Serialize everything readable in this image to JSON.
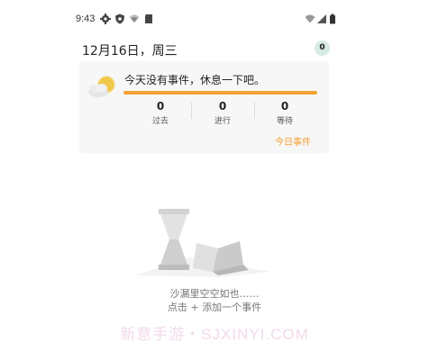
{
  "status_bar": {
    "time": "9:43",
    "left_icons": [
      "gear-icon",
      "shield-icon",
      "wifi-off-icon",
      "sd-card-icon"
    ],
    "right_icons": [
      "wifi-icon",
      "signal-icon",
      "battery-icon"
    ]
  },
  "header": {
    "date_title": "12月16日，周三",
    "badge_count": "0"
  },
  "summary_card": {
    "message": "今天没有事件，休息一下吧。",
    "progress_fraction": 1.0,
    "accent_color": "#f4a133",
    "stats": [
      {
        "value": "0",
        "label": "过去"
      },
      {
        "value": "0",
        "label": "进行"
      },
      {
        "value": "0",
        "label": "等待"
      }
    ],
    "today_events_link": "今日事件"
  },
  "empty_state": {
    "line1": "沙漏里空空如也……",
    "line2": "点击 + 添加一个事件"
  },
  "watermark": "新意手游・SJXINYI.COM"
}
